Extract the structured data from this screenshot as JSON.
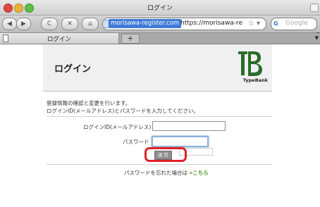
{
  "window": {
    "title": "ログイン"
  },
  "toolbar": {
    "back_icon": "◀",
    "forward_icon": "▶",
    "reload_icon": "C",
    "stop_icon": "✕",
    "home_icon": "⌂",
    "url_domain": "morisawa-register.com",
    "url_text": "https://morisawa-re",
    "search_placeholder": "Google",
    "star_icon": "☆ ▾"
  },
  "tabs": [
    {
      "label": "ログイン"
    }
  ],
  "tab_add": "+",
  "page": {
    "title": "ログイン",
    "logo_text": "TypeBank",
    "intro_line1": "登録情報の確認と変更を行います。",
    "intro_line2": "ログインID(メールアドレス)とパスワードを入力してください。",
    "login_id_label": "ログインID(メールアドレス)",
    "password_label": "パスワード",
    "login_id_value": "",
    "password_value": "",
    "submit_label": "送 信",
    "forgot_text": "パスワードを忘れた場合は",
    "forgot_link": "»こちら"
  },
  "colors": {
    "accent": "#3e7bd6",
    "highlight": "#e02026",
    "link": "#4c9a2a"
  }
}
